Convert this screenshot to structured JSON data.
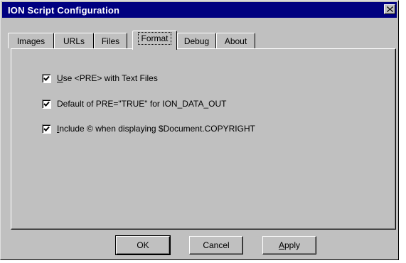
{
  "window": {
    "title": "ION Script Configuration",
    "close_symbol": "✕"
  },
  "tabs": [
    {
      "label": "Images",
      "active": false
    },
    {
      "label": "URLs",
      "active": false
    },
    {
      "label": "Files",
      "active": false
    },
    {
      "label": "Format",
      "active": true
    },
    {
      "label": "Debug",
      "active": false
    },
    {
      "label": "About",
      "active": false
    }
  ],
  "options": [
    {
      "mnemonic": "U",
      "rest": "se <PRE> with Text Files",
      "checked": true
    },
    {
      "mnemonic": "",
      "rest": "Default of PRE=\"TRUE\" for ION_DATA_OUT",
      "checked": true
    },
    {
      "mnemonic": "I",
      "rest": "nclude © when displaying $Document.COPYRIGHT",
      "checked": true
    }
  ],
  "buttons": {
    "ok": "OK",
    "cancel": "Cancel",
    "apply_mnemonic": "A",
    "apply_rest": "pply"
  },
  "colors": {
    "face": "#c0c0c0",
    "titlebar": "#000080"
  }
}
